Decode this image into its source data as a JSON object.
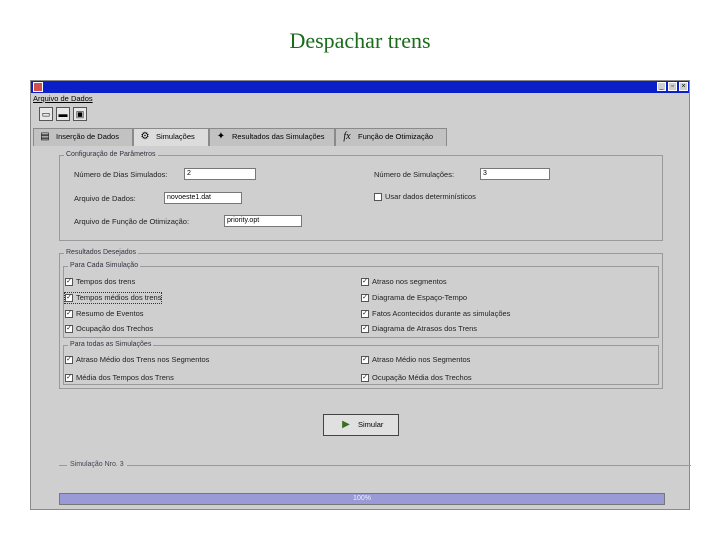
{
  "slide": {
    "title": "Despachar trens"
  },
  "window": {
    "menu": {
      "file_label": "Arquivo de Dados"
    },
    "toolbar": {
      "buttons": [
        {
          "icon": "new-document-icon"
        },
        {
          "icon": "open-folder-icon"
        },
        {
          "icon": "save-disk-icon"
        }
      ]
    },
    "tabs": [
      {
        "label": "Inserção de Dados",
        "icon": "table-icon"
      },
      {
        "label": "Simulações",
        "icon": "gear-icon"
      },
      {
        "label": "Resultados das Simulações",
        "icon": "results-icon"
      },
      {
        "label": "Função de Otimização",
        "icon": "fx-icon"
      }
    ],
    "active_tab": "Simulações"
  },
  "config": {
    "legend": "Configuração de Parâmetros",
    "days_label": "Número de Dias Simulados:",
    "days_value": "2",
    "sims_label": "Número de Simulações:",
    "sims_value": "3",
    "data_file_label": "Arquivo de Dados:",
    "data_file_value": "novoeste1.dat",
    "deterministic_label": "Usar dados determinísticos",
    "deterministic_checked": false,
    "opt_file_label": "Arquivo de Função de Otimização:",
    "opt_file_value": "priority.opt"
  },
  "results": {
    "legend": "Resultados Desejados",
    "per_sim": {
      "legend": "Para Cada Simulação",
      "left": [
        {
          "label": "Tempos dos trens",
          "checked": true
        },
        {
          "label": "Tempos médios dos trens",
          "checked": true
        },
        {
          "label": "Resumo de Eventos",
          "checked": true
        },
        {
          "label": "Ocupação dos Trechos",
          "checked": true
        }
      ],
      "right": [
        {
          "label": "Atraso nos segmentos",
          "checked": true
        },
        {
          "label": "Diagrama de Espaço-Tempo",
          "checked": true
        },
        {
          "label": "Fatos Acontecidos durante as simulações",
          "checked": true
        },
        {
          "label": "Diagrama de Atrasos dos Trens",
          "checked": true
        }
      ]
    },
    "all_sims": {
      "legend": "Para todas as Simulações",
      "left": [
        {
          "label": "Atraso Médio dos Trens nos Segmentos",
          "checked": true
        },
        {
          "label": "Média dos Tempos dos Trens",
          "checked": true
        }
      ],
      "right": [
        {
          "label": "Atraso Médio nos Segmentos",
          "checked": true
        },
        {
          "label": "Ocupação Média dos Trechos",
          "checked": true
        }
      ]
    }
  },
  "simulate_button": {
    "label": "Simular",
    "icon": "simulate-icon"
  },
  "status": {
    "label": "Simulação Nro. 3",
    "progress_text": "100%",
    "progress_fraction": 1.0
  },
  "colors": {
    "title_text": "#1a6b1a",
    "titlebar": "#0a1fc8",
    "progress_fill": "#9a9ad6"
  }
}
